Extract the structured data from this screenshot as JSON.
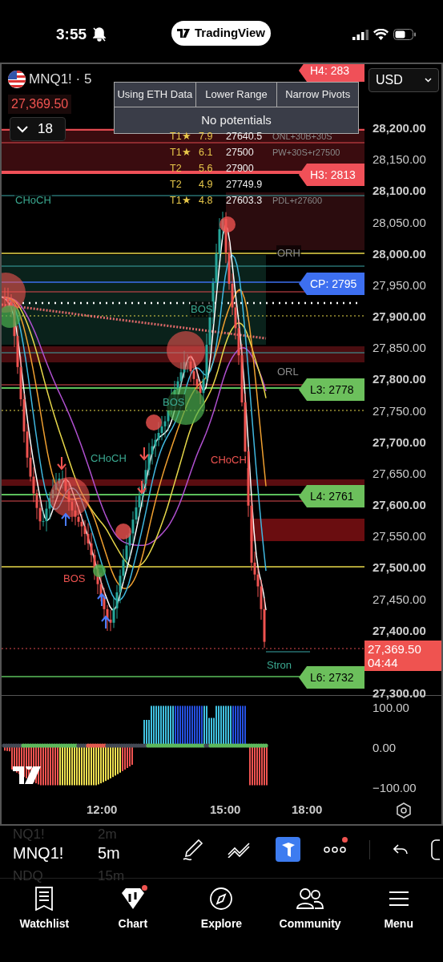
{
  "status_bar": {
    "time": "3:55",
    "app": "TradingView"
  },
  "chart": {
    "symbol": "MNQ1! · 5",
    "last_price": "27,369.50",
    "indicator_count": "18",
    "currency": "USD",
    "info_table": {
      "headers": [
        "Using ETH Data",
        "Lower Range",
        "Narrow Pivots"
      ],
      "message": "No potentials"
    },
    "targets": [
      {
        "tier": "T1★",
        "score": "7.9",
        "price": "27640.5",
        "note": "ONL+30B+30S"
      },
      {
        "tier": "T1★",
        "score": "6.1",
        "price": "27500",
        "note": "PW+30S+r27500"
      },
      {
        "tier": "T2",
        "score": "5.6",
        "price": "27900"
      },
      {
        "tier": "T2",
        "score": "4.9",
        "price": "27749.9"
      },
      {
        "tier": "T1★",
        "score": "4.8",
        "price": "27603.3",
        "note": "PDL+r27600"
      }
    ],
    "price_axis": [
      "28,200.00",
      "28,150.00",
      "28,100.00",
      "28,050.00",
      "28,000.00",
      "27,950.00",
      "27,900.00",
      "27,850.00",
      "27,800.00",
      "27,750.00",
      "27,700.00",
      "27,650.00",
      "27,600.00",
      "27,550.00",
      "27,500.00",
      "27,450.00",
      "27,400.00",
      "27,300.00"
    ],
    "level_tags": [
      {
        "label": "H4: 283",
        "kind": "resistance"
      },
      {
        "label": "H3: 2813",
        "kind": "resistance"
      },
      {
        "label": "CP: 2795",
        "kind": "pivot"
      },
      {
        "label": "L3: 2778",
        "kind": "support"
      },
      {
        "label": "L4: 2761",
        "kind": "support"
      },
      {
        "label": "L6: 2732",
        "kind": "support"
      }
    ],
    "annotations": [
      {
        "text": "CHoCH",
        "kind": "bull"
      },
      {
        "text": "ORH",
        "kind": "level"
      },
      {
        "text": "BOS",
        "kind": "bull"
      },
      {
        "text": "ORL",
        "kind": "level"
      },
      {
        "text": "BOS",
        "kind": "bull"
      },
      {
        "text": "CHoCH",
        "kind": "bull"
      },
      {
        "text": "CHoCH",
        "kind": "bear"
      },
      {
        "text": "BOS",
        "kind": "bear"
      },
      {
        "text": "Stron",
        "kind": "bull"
      }
    ],
    "current_price": {
      "price": "27,369.50",
      "countdown": "04:44"
    }
  },
  "oscillator": {
    "axis": [
      "100.00",
      "0.00",
      "−100.00"
    ]
  },
  "time_axis": [
    "12:00",
    "15:00",
    "18:00"
  ],
  "toolbar": {
    "symbols": [
      {
        "text": "NQ1!",
        "selected": false
      },
      {
        "text": "MNQ1!",
        "selected": true
      },
      {
        "text": "NDQ",
        "selected": false
      }
    ],
    "intervals": [
      {
        "text": "2m",
        "selected": false
      },
      {
        "text": "5m",
        "selected": true
      },
      {
        "text": "15m",
        "selected": false
      }
    ],
    "more_badge": true
  },
  "nav": [
    {
      "label": "Watchlist",
      "badge": false
    },
    {
      "label": "Chart",
      "badge": true
    },
    {
      "label": "Explore",
      "badge": false
    },
    {
      "label": "Community",
      "badge": false
    },
    {
      "label": "Menu",
      "badge": false
    }
  ]
}
